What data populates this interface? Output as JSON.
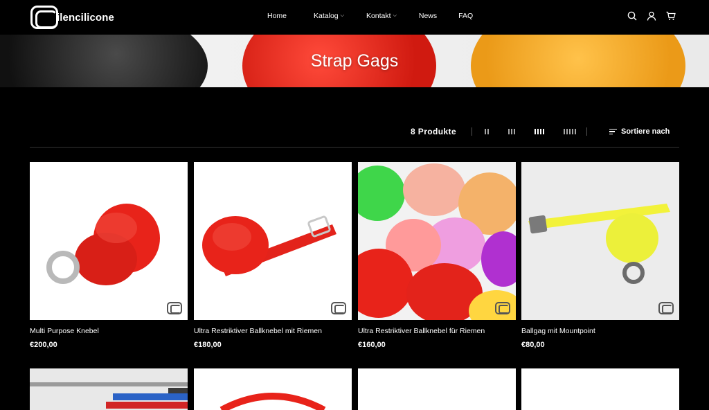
{
  "brand": {
    "name": "ilencilicone"
  },
  "nav": {
    "items": [
      {
        "label": "Home",
        "dropdown": false
      },
      {
        "label": "Katalog",
        "dropdown": true
      },
      {
        "label": "Kontakt",
        "dropdown": true
      },
      {
        "label": "News",
        "dropdown": false
      },
      {
        "label": "FAQ",
        "dropdown": false
      }
    ]
  },
  "header_icons": [
    "search-icon",
    "account-icon",
    "cart-icon"
  ],
  "hero": {
    "title": "Strap Gags"
  },
  "toolbar": {
    "count": "8 Produkte",
    "grid_options": [
      2,
      3,
      4,
      5
    ],
    "grid_selected": 4,
    "sort_label": "Sortiere nach"
  },
  "products": [
    {
      "name": "Multi Purpose Knebel",
      "price": "€200,00"
    },
    {
      "name": "Ultra Restriktiver Ballknebel mit Riemen",
      "price": "€180,00"
    },
    {
      "name": "Ultra Restriktiver Ballknebel für Riemen",
      "price": "€160,00"
    },
    {
      "name": "Ballgag mit Mountpoint",
      "price": "€80,00"
    }
  ],
  "colors": {
    "background": "#000000",
    "text": "#ffffff",
    "red": "#e8231a",
    "yellow": "#f2f23a",
    "orange": "#f6a623"
  }
}
